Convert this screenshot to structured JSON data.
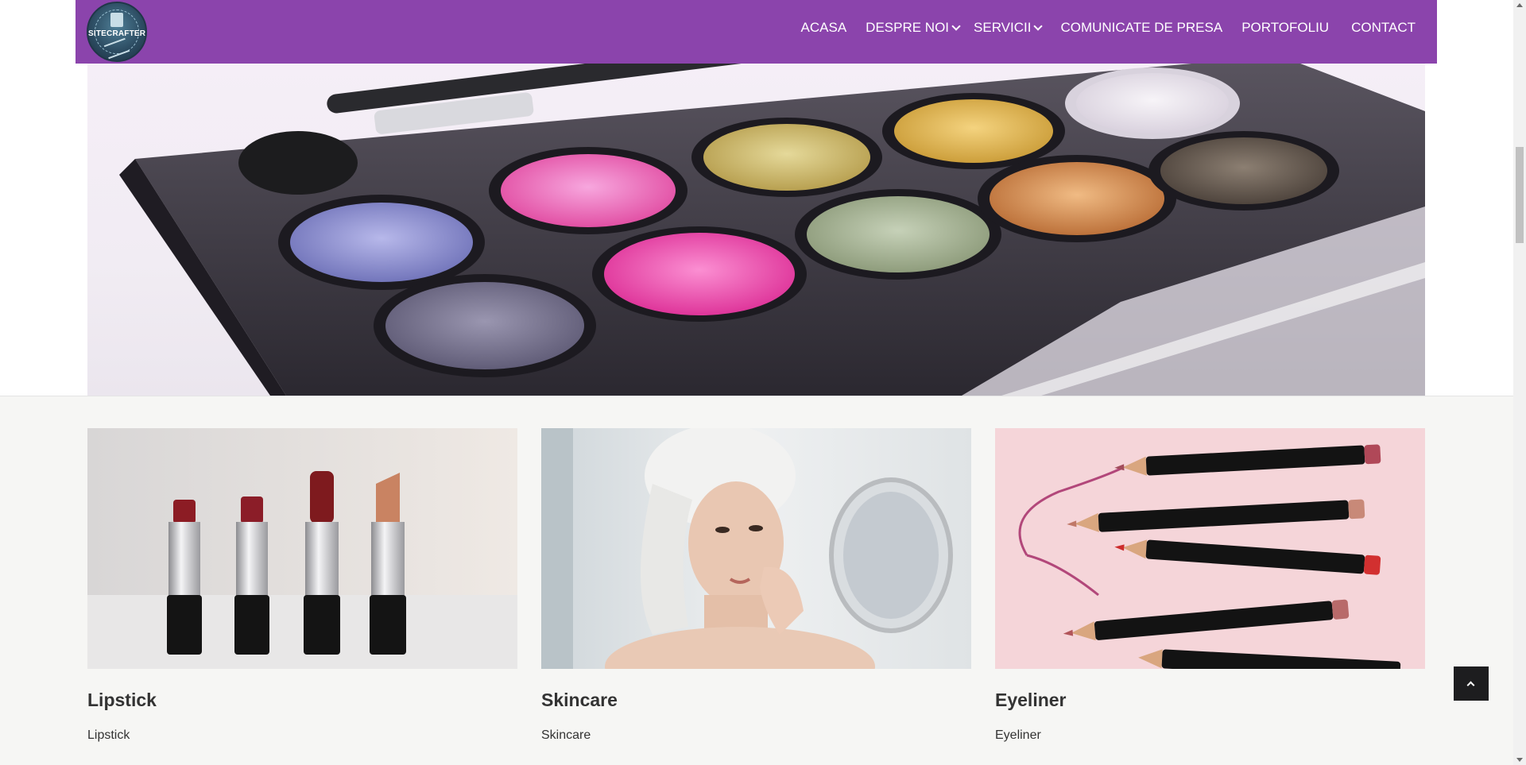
{
  "header": {
    "logo_text": "SITECRAFTER",
    "background_color": "#8b44ac",
    "nav": [
      {
        "label": "ACASA",
        "has_dropdown": false
      },
      {
        "label": "DESPRE NOI",
        "has_dropdown": true
      },
      {
        "label": "SERVICII",
        "has_dropdown": true
      },
      {
        "label": "COMUNICATE DE PRESA",
        "has_dropdown": false
      },
      {
        "label": "PORTOFOLIU",
        "has_dropdown": false
      },
      {
        "label": "CONTACT",
        "has_dropdown": false
      }
    ]
  },
  "hero": {
    "image_subject": "eyeshadow-palette-photo"
  },
  "cards": [
    {
      "title": "Lipstick",
      "text": "Lipstick",
      "image_subject": "lipsticks-photo"
    },
    {
      "title": "Skincare",
      "text": "Skincare",
      "image_subject": "woman-skincare-photo"
    },
    {
      "title": "Eyeliner",
      "text": "Eyeliner",
      "image_subject": "eyeliner-pencils-photo"
    }
  ],
  "back_to_top": {
    "icon": "chevron-up-icon"
  }
}
